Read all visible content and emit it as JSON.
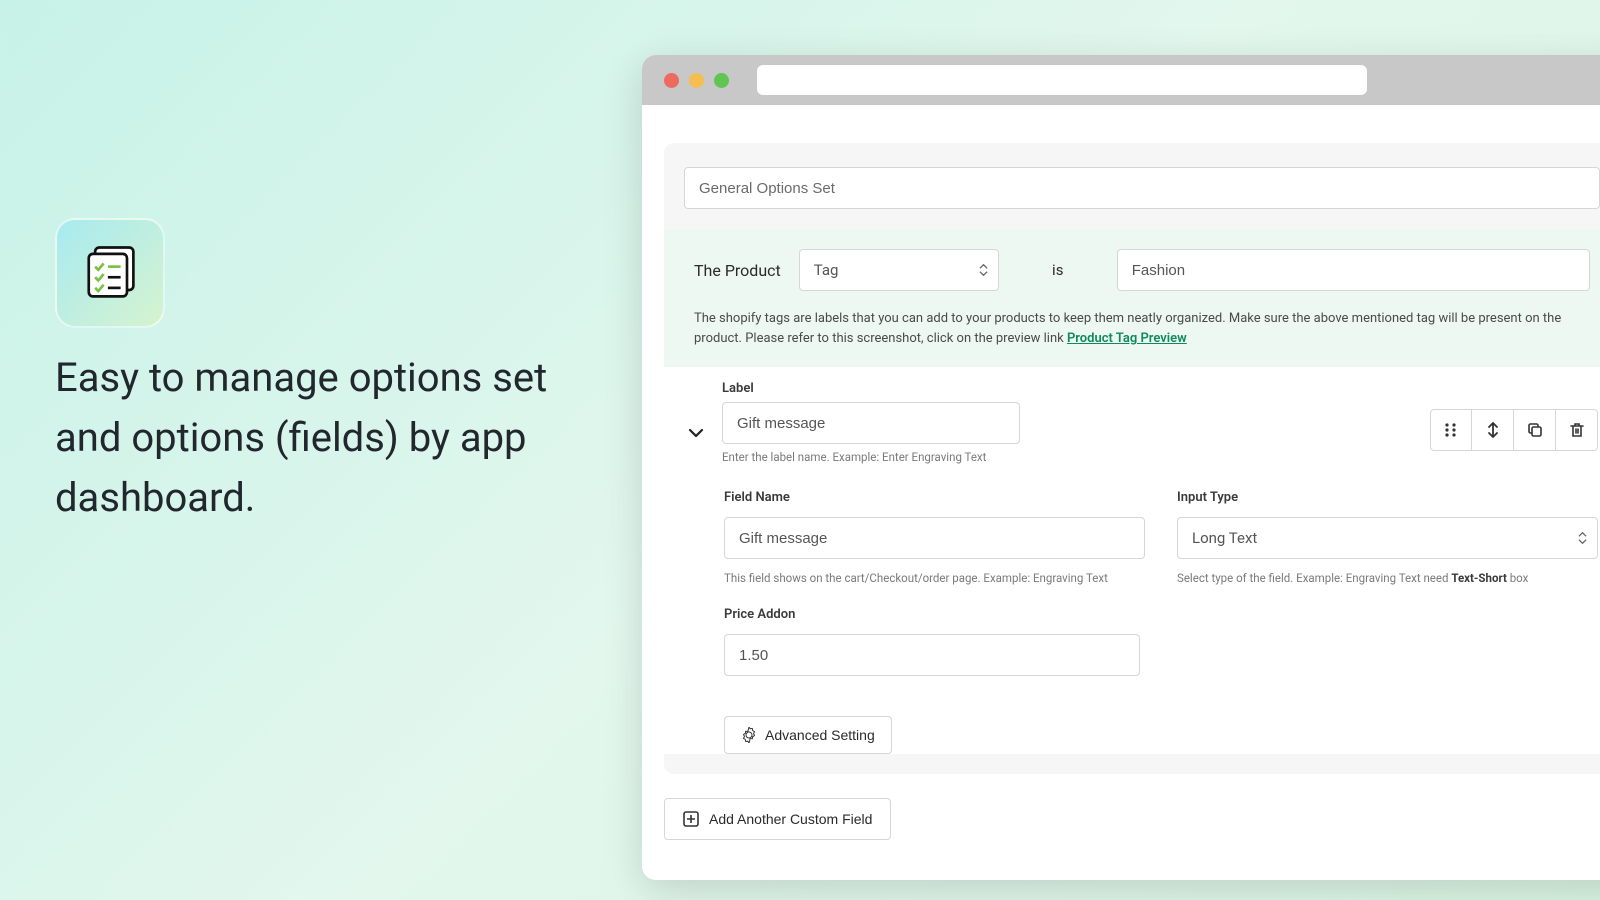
{
  "promo": {
    "headline": "Easy to manage options set and options (fields) by app dashboard."
  },
  "form": {
    "optionSetName": "General Options Set",
    "condition": {
      "prefix": "The Product",
      "attribute": "Tag",
      "operator": "is",
      "value": "Fashion"
    },
    "conditionHint": "The shopify tags are labels that you can add to your products to keep them neatly organized. Make sure the above mentioned tag will be present on the product. Please refer to this screenshot, click on the preview link ",
    "conditionHintLink": "Product Tag Preview",
    "field": {
      "labelTitle": "Label",
      "labelValue": "Gift message",
      "labelHelp": "Enter the label name. Example: Enter Engraving Text",
      "fieldNameTitle": "Field Name",
      "fieldNameValue": "Gift message",
      "fieldNameHelp": "This field shows on the cart/Checkout/order page. Example: Engraving Text",
      "inputTypeTitle": "Input Type",
      "inputTypeValue": "Long Text",
      "inputTypeHelpPrefix": "Select type of the field. Example: Engraving Text need ",
      "inputTypeHelpBold": "Text-Short",
      "inputTypeHelpSuffix": " box",
      "priceAddonTitle": "Price Addon",
      "priceAddonValue": "1.50"
    },
    "advancedSettingLabel": "Advanced Setting",
    "addFieldLabel": "Add Another Custom Field"
  }
}
